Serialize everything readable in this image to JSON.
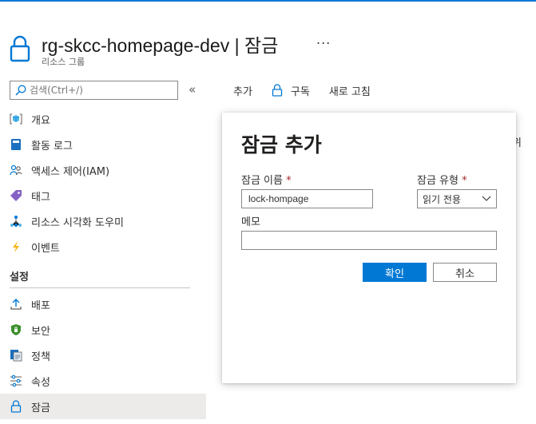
{
  "header": {
    "title": "rg-skcc-homepage-dev | 잠금",
    "subtitle": "리소스 그룹",
    "more": "..."
  },
  "sidebar": {
    "search_placeholder": "검색(Ctrl+/)",
    "collapse": "«",
    "items": [
      {
        "label": "개요",
        "icon": "overview-cube-icon"
      },
      {
        "label": "활동 로그",
        "icon": "activity-log-icon"
      },
      {
        "label": "액세스 제어(IAM)",
        "icon": "iam-users-icon"
      },
      {
        "label": "태그",
        "icon": "tag-icon"
      },
      {
        "label": "리소스 시각화 도우미",
        "icon": "resource-visualizer-icon"
      },
      {
        "label": "이벤트",
        "icon": "lightning-icon"
      }
    ],
    "section_settings": "설정",
    "settings_items": [
      {
        "label": "배포",
        "icon": "deploy-upload-icon"
      },
      {
        "label": "보안",
        "icon": "security-shield-icon"
      },
      {
        "label": "정책",
        "icon": "policy-icon"
      },
      {
        "label": "속성",
        "icon": "properties-sliders-icon"
      },
      {
        "label": "잠금",
        "icon": "lock-icon",
        "active": true
      }
    ]
  },
  "toolbar": {
    "add": "추가",
    "subscription": "구독",
    "refresh": "새로 고침"
  },
  "right_fragment": "위",
  "dialog": {
    "title": "잠금 추가",
    "lock_name_label": "잠금 이름",
    "required_mark": "*",
    "lock_name_value": "lock-hompage",
    "lock_type_label": "잠금 유형",
    "lock_type_value": "읽기 전용",
    "memo_label": "메모",
    "memo_value": "",
    "ok": "확인",
    "cancel": "취소"
  },
  "colors": {
    "accent": "#0078d4",
    "required": "#a4262c"
  }
}
